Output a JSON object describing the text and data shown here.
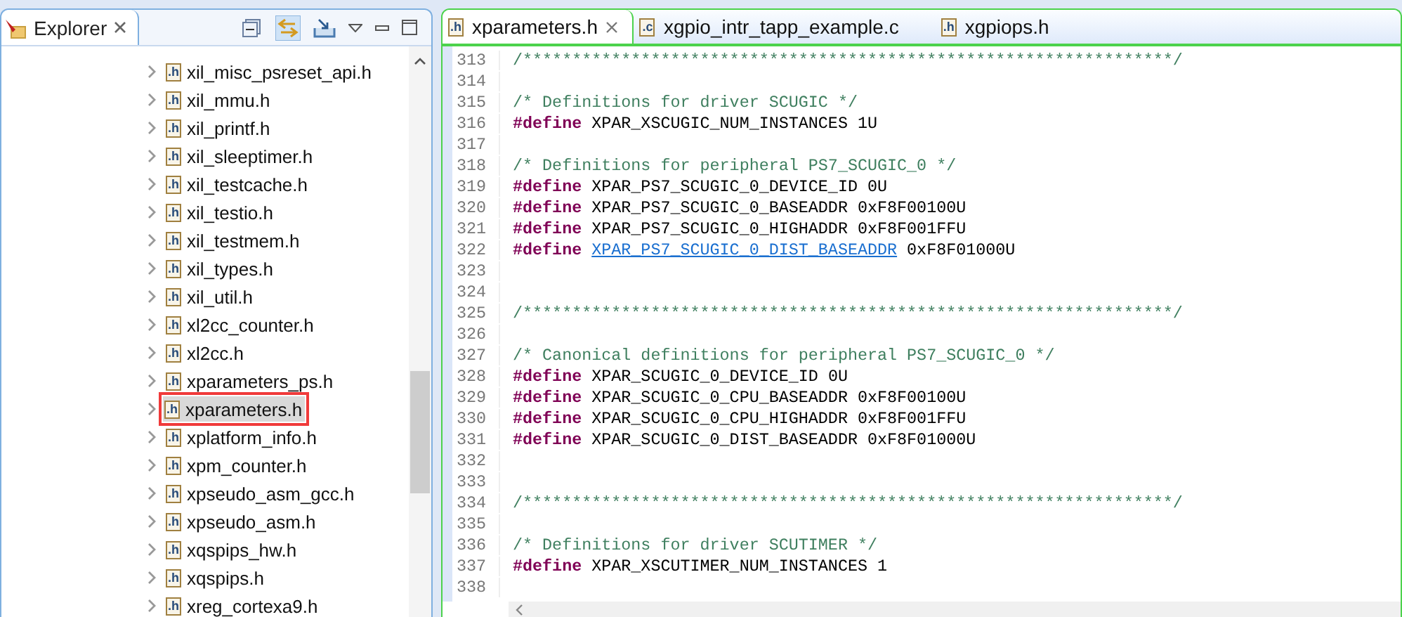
{
  "explorer": {
    "title": "Explorer",
    "items": [
      {
        "name": "xil_misc_psreset_api.h",
        "icon": ".h",
        "selected": false,
        "highlighted": false
      },
      {
        "name": "xil_mmu.h",
        "icon": ".h",
        "selected": false,
        "highlighted": false
      },
      {
        "name": "xil_printf.h",
        "icon": ".h",
        "selected": false,
        "highlighted": false
      },
      {
        "name": "xil_sleeptimer.h",
        "icon": ".h",
        "selected": false,
        "highlighted": false
      },
      {
        "name": "xil_testcache.h",
        "icon": ".h",
        "selected": false,
        "highlighted": false
      },
      {
        "name": "xil_testio.h",
        "icon": ".h",
        "selected": false,
        "highlighted": false
      },
      {
        "name": "xil_testmem.h",
        "icon": ".h",
        "selected": false,
        "highlighted": false
      },
      {
        "name": "xil_types.h",
        "icon": ".h",
        "selected": false,
        "highlighted": false
      },
      {
        "name": "xil_util.h",
        "icon": ".h",
        "selected": false,
        "highlighted": false
      },
      {
        "name": "xl2cc_counter.h",
        "icon": ".h",
        "selected": false,
        "highlighted": false
      },
      {
        "name": "xl2cc.h",
        "icon": ".h",
        "selected": false,
        "highlighted": false
      },
      {
        "name": "xparameters_ps.h",
        "icon": ".h",
        "selected": false,
        "highlighted": false
      },
      {
        "name": "xparameters.h",
        "icon": ".h",
        "selected": true,
        "highlighted": true
      },
      {
        "name": "xplatform_info.h",
        "icon": ".h",
        "selected": false,
        "highlighted": false
      },
      {
        "name": "xpm_counter.h",
        "icon": ".h",
        "selected": false,
        "highlighted": false
      },
      {
        "name": "xpseudo_asm_gcc.h",
        "icon": ".h",
        "selected": false,
        "highlighted": false
      },
      {
        "name": "xpseudo_asm.h",
        "icon": ".h",
        "selected": false,
        "highlighted": false
      },
      {
        "name": "xqspips_hw.h",
        "icon": ".h",
        "selected": false,
        "highlighted": false
      },
      {
        "name": "xqspips.h",
        "icon": ".h",
        "selected": false,
        "highlighted": false
      },
      {
        "name": "xreg_cortexa9.h",
        "icon": ".h",
        "selected": false,
        "highlighted": false
      }
    ]
  },
  "tabs": [
    {
      "label": "xparameters.h",
      "icon": ".h",
      "selected": true
    },
    {
      "label": "xgpio_intr_tapp_example.c",
      "icon": ".c",
      "selected": false
    },
    {
      "label": "xgpiops.h",
      "icon": ".h",
      "selected": false
    }
  ],
  "code": [
    {
      "num": "313",
      "kind": "comment",
      "text": "/******************************************************************/"
    },
    {
      "num": "314",
      "kind": "blank"
    },
    {
      "num": "315",
      "kind": "comment",
      "text": "/* Definitions for driver SCUGIC */"
    },
    {
      "num": "316",
      "kind": "define",
      "keyword": "#define",
      "name": "XPAR_XSCUGIC_NUM_INSTANCES",
      "value": "1U",
      "linked": false
    },
    {
      "num": "317",
      "kind": "blank"
    },
    {
      "num": "318",
      "kind": "comment",
      "text": "/* Definitions for peripheral PS7_SCUGIC_0 */"
    },
    {
      "num": "319",
      "kind": "define",
      "keyword": "#define",
      "name": "XPAR_PS7_SCUGIC_0_DEVICE_ID",
      "value": "0U",
      "linked": false
    },
    {
      "num": "320",
      "kind": "define",
      "keyword": "#define",
      "name": "XPAR_PS7_SCUGIC_0_BASEADDR",
      "value": "0xF8F00100U",
      "linked": false
    },
    {
      "num": "321",
      "kind": "define",
      "keyword": "#define",
      "name": "XPAR_PS7_SCUGIC_0_HIGHADDR",
      "value": "0xF8F001FFU",
      "linked": false
    },
    {
      "num": "322",
      "kind": "define",
      "keyword": "#define",
      "name": "XPAR_PS7_SCUGIC_0_DIST_BASEADDR",
      "value": "0xF8F01000U",
      "linked": true
    },
    {
      "num": "323",
      "kind": "blank"
    },
    {
      "num": "324",
      "kind": "blank"
    },
    {
      "num": "325",
      "kind": "comment",
      "text": "/******************************************************************/"
    },
    {
      "num": "326",
      "kind": "blank"
    },
    {
      "num": "327",
      "kind": "comment",
      "text": "/* Canonical definitions for peripheral PS7_SCUGIC_0 */"
    },
    {
      "num": "328",
      "kind": "define",
      "keyword": "#define",
      "name": "XPAR_SCUGIC_0_DEVICE_ID",
      "value": "0U",
      "linked": false
    },
    {
      "num": "329",
      "kind": "define",
      "keyword": "#define",
      "name": "XPAR_SCUGIC_0_CPU_BASEADDR",
      "value": "0xF8F00100U",
      "linked": false
    },
    {
      "num": "330",
      "kind": "define",
      "keyword": "#define",
      "name": "XPAR_SCUGIC_0_CPU_HIGHADDR",
      "value": "0xF8F001FFU",
      "linked": false
    },
    {
      "num": "331",
      "kind": "define",
      "keyword": "#define",
      "name": "XPAR_SCUGIC_0_DIST_BASEADDR",
      "value": "0xF8F01000U",
      "linked": false
    },
    {
      "num": "332",
      "kind": "blank"
    },
    {
      "num": "333",
      "kind": "blank"
    },
    {
      "num": "334",
      "kind": "comment",
      "text": "/******************************************************************/"
    },
    {
      "num": "335",
      "kind": "blank"
    },
    {
      "num": "336",
      "kind": "comment",
      "text": "/* Definitions for driver SCUTIMER */"
    },
    {
      "num": "337",
      "kind": "define",
      "keyword": "#define",
      "name": "XPAR_XSCUTIMER_NUM_INSTANCES",
      "value": "1",
      "linked": false
    },
    {
      "num": "338",
      "kind": "blank"
    }
  ]
}
